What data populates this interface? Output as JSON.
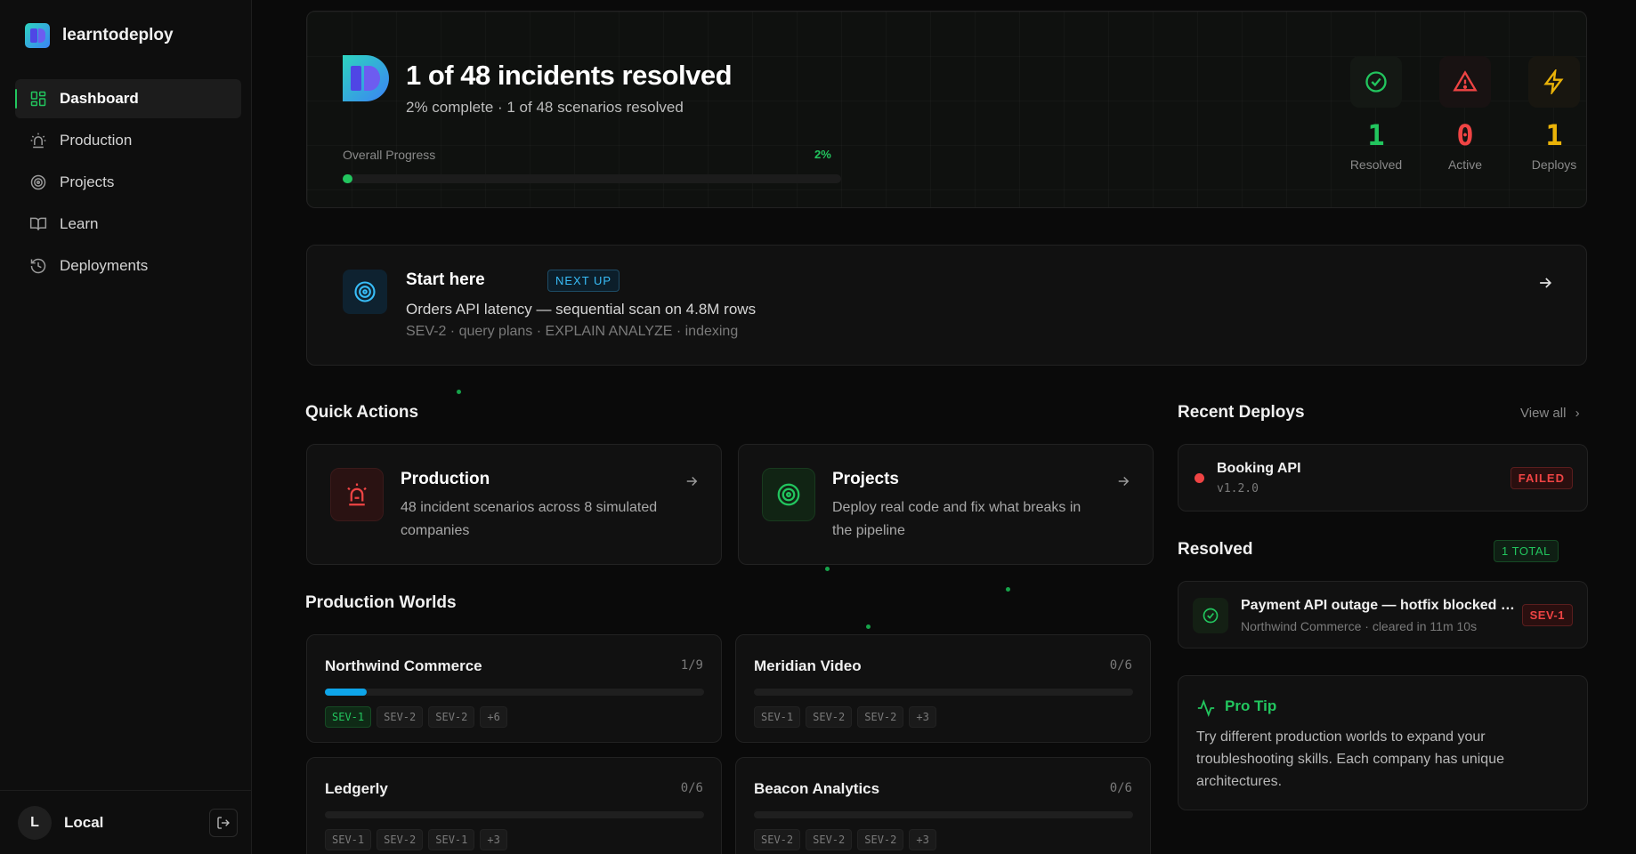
{
  "app": {
    "name": "learntodeploy"
  },
  "sidebar": {
    "items": [
      {
        "label": "Dashboard",
        "icon": "grid-icon",
        "active": true
      },
      {
        "label": "Production",
        "icon": "siren-icon",
        "active": false
      },
      {
        "label": "Projects",
        "icon": "target-icon",
        "active": false
      },
      {
        "label": "Learn",
        "icon": "book-icon",
        "active": false
      },
      {
        "label": "Deployments",
        "icon": "history-icon",
        "active": false
      }
    ],
    "user": {
      "initial": "L",
      "name": "Local"
    }
  },
  "hero": {
    "title": "1 of 48 incidents resolved",
    "subtitle": "2% complete · 1 of 48 scenarios resolved",
    "progress_label": "Overall Progress",
    "progress_text": "2%",
    "progress_fraction": 0.02,
    "stats": [
      {
        "value": "1",
        "label": "Resolved",
        "color": "#22c55e"
      },
      {
        "value": "0",
        "label": "Active",
        "color": "#ef4444"
      },
      {
        "value": "1",
        "label": "Deploys",
        "color": "#eab308"
      }
    ]
  },
  "start": {
    "title": "Start here",
    "badge": "NEXT UP",
    "description": "Orders API latency — sequential scan on 4.8M rows",
    "meta": "SEV-2 · query plans · EXPLAIN ANALYZE · indexing"
  },
  "quick_actions": {
    "title": "Quick Actions",
    "items": [
      {
        "title": "Production",
        "description": "48 incident scenarios across 8 simulated companies"
      },
      {
        "title": "Projects",
        "description": "Deploy real code and fix what breaks in the pipeline"
      }
    ]
  },
  "worlds": {
    "title": "Production Worlds",
    "items": [
      {
        "name": "Northwind Commerce",
        "count": "1/9",
        "progress": 0.11,
        "chips": [
          "SEV-1",
          "SEV-2",
          "SEV-2",
          "+6"
        ]
      },
      {
        "name": "Meridian Video",
        "count": "0/6",
        "progress": 0,
        "chips": [
          "SEV-1",
          "SEV-2",
          "SEV-2",
          "+3"
        ]
      },
      {
        "name": "Ledgerly",
        "count": "0/6",
        "progress": 0,
        "chips": [
          "SEV-1",
          "SEV-2",
          "SEV-1",
          "+3"
        ]
      },
      {
        "name": "Beacon Analytics",
        "count": "0/6",
        "progress": 0,
        "chips": [
          "SEV-2",
          "SEV-2",
          "SEV-2",
          "+3"
        ]
      }
    ]
  },
  "recent_deploys": {
    "title": "Recent Deploys",
    "view_all": "View all",
    "items": [
      {
        "name": "Booking API",
        "version": "v1.2.0",
        "status": "FAILED"
      }
    ]
  },
  "resolved": {
    "title": "Resolved",
    "badge": "1 TOTAL",
    "items": [
      {
        "title": "Payment API outage — hotfix blocked by flaky pipeline",
        "meta": "Northwind Commerce · cleared in 11m 10s",
        "severity": "SEV-1"
      }
    ]
  },
  "tip": {
    "title": "Pro Tip",
    "body": "Try different production worlds to expand your troubleshooting skills. Each company has unique architectures."
  }
}
